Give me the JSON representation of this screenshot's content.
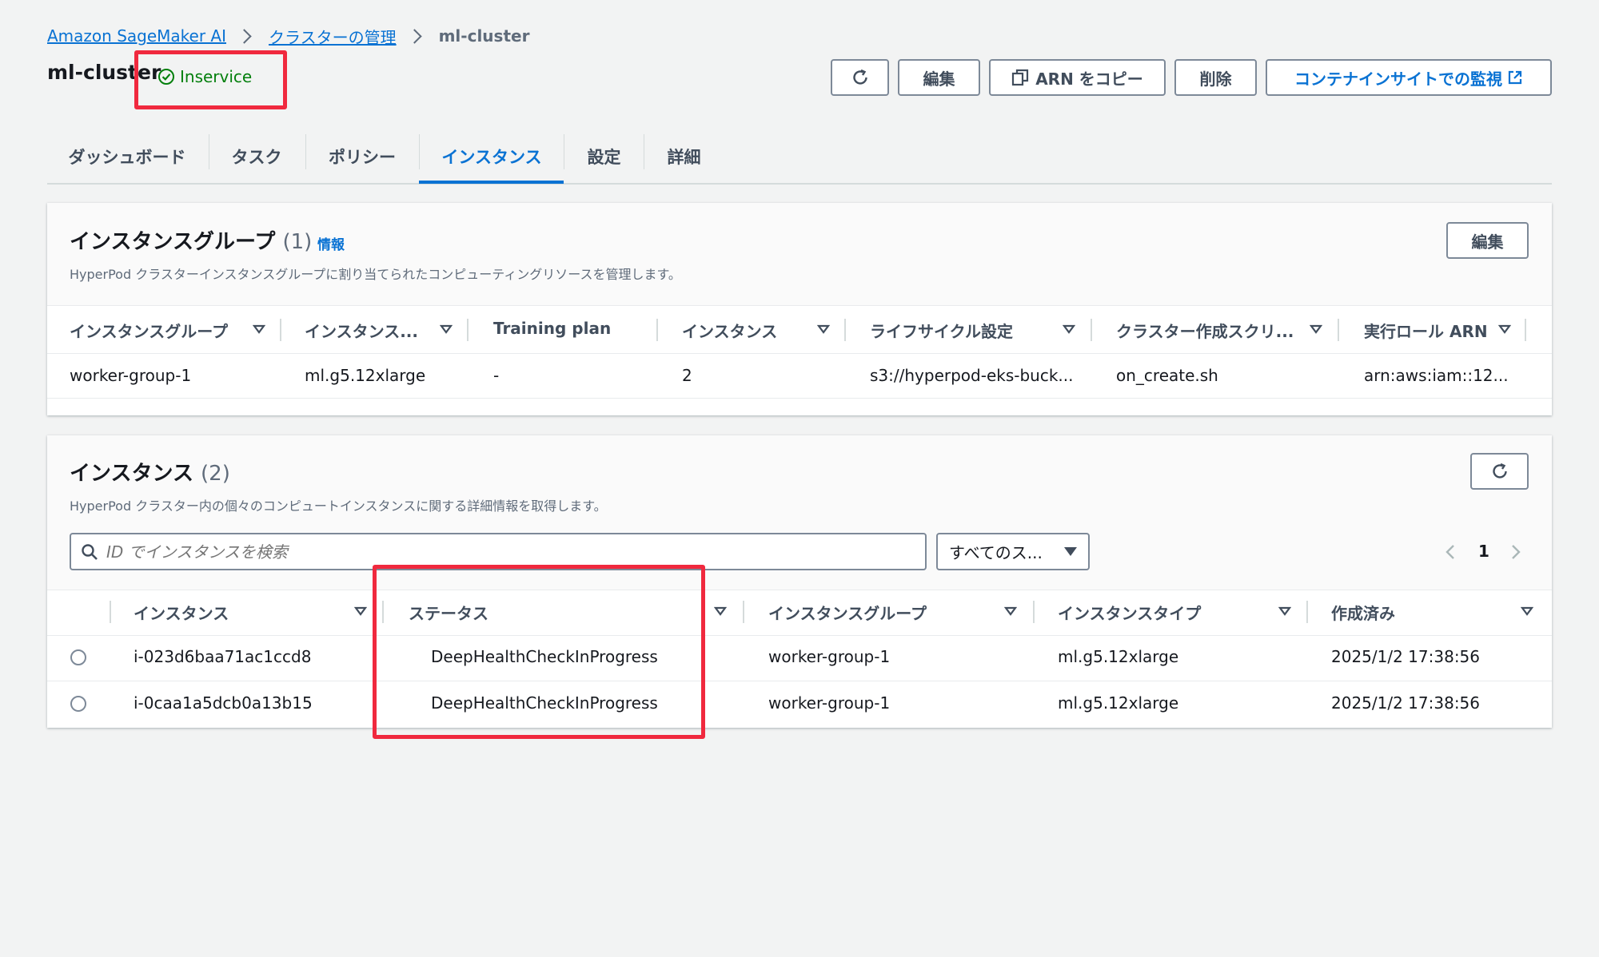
{
  "breadcrumb": {
    "items": [
      "Amazon SageMaker AI",
      "クラスターの管理"
    ],
    "current": "ml-cluster"
  },
  "header": {
    "title": "ml-cluster",
    "status": "Inservice",
    "buttons": {
      "edit": "編集",
      "copy_arn": "ARN をコピー",
      "delete": "削除",
      "monitor": "コンテナインサイトでの監視"
    }
  },
  "tabs": [
    "ダッシュボード",
    "タスク",
    "ポリシー",
    "インスタンス",
    "設定",
    "詳細"
  ],
  "active_tab": "インスタンス",
  "instance_groups": {
    "title": "インスタンスグループ",
    "count": "(1)",
    "info": "情報",
    "description": "HyperPod クラスターインスタンスグループに割り当てられたコンピューティングリソースを管理します。",
    "edit_button": "編集",
    "columns": [
      "インスタンスグループ",
      "インスタンス...",
      "Training plan",
      "インスタンス",
      "ライフサイクル設定",
      "クラスター作成スクリ...",
      "実行ロール ARN"
    ],
    "rows": [
      [
        "worker-group-1",
        "ml.g5.12xlarge",
        "-",
        "2",
        "s3://hyperpod-eks-buck...",
        "on_create.sh",
        "arn:aws:iam::12..."
      ]
    ]
  },
  "instances": {
    "title": "インスタンス",
    "count": "(2)",
    "description": "HyperPod クラスター内の個々のコンピュートインスタンスに関する詳細情報を取得します。",
    "search_placeholder": "ID でインスタンスを検索",
    "filter_value": "すべてのス...",
    "page": "1",
    "columns": [
      "インスタンス",
      "ステータス",
      "インスタンスグループ",
      "インスタンスタイプ",
      "作成済み"
    ],
    "rows": [
      [
        "i-023d6baa71ac1ccd8",
        "DeepHealthCheckInProgress",
        "worker-group-1",
        "ml.g5.12xlarge",
        "2025/1/2 17:38:56"
      ],
      [
        "i-0caa1a5dcb0a13b15",
        "DeepHealthCheckInProgress",
        "worker-group-1",
        "ml.g5.12xlarge",
        "2025/1/2 17:38:56"
      ]
    ]
  },
  "colors": {
    "link": "#0972d3",
    "success": "#037f0c",
    "highlight": "#f0293e",
    "background": "#f2f3f3"
  },
  "icons": [
    "chevron-right-icon",
    "check-circle-icon",
    "refresh-icon",
    "copy-icon",
    "external-link-icon",
    "search-icon",
    "caret-down-icon",
    "sort-icon",
    "chevron-left-icon"
  ]
}
